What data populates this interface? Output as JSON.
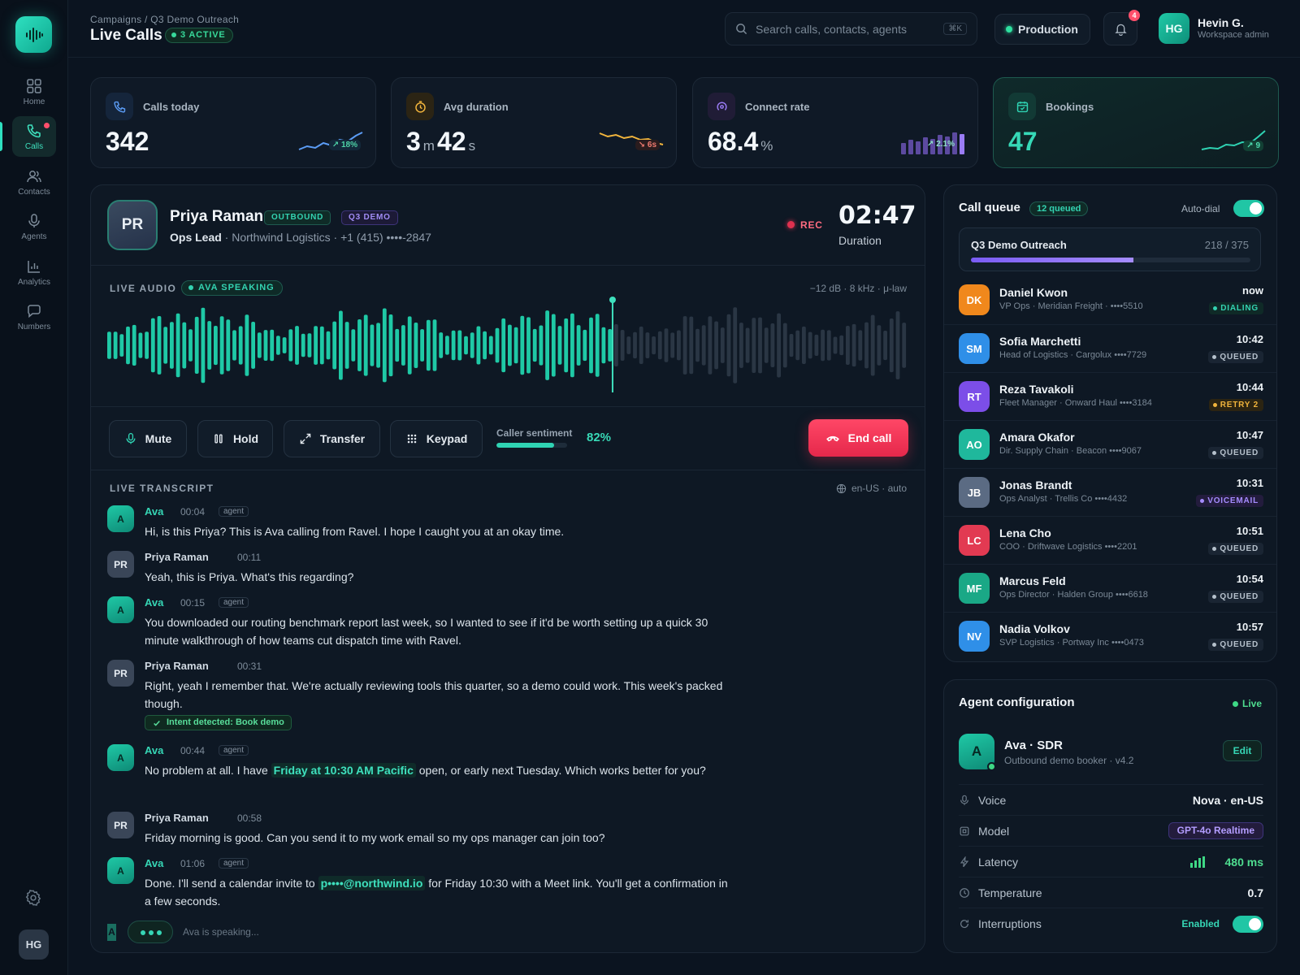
{
  "sidebar": {
    "items": [
      {
        "label": "Home"
      },
      {
        "label": "Calls"
      },
      {
        "label": "Contacts"
      },
      {
        "label": "Agents"
      },
      {
        "label": "Analytics"
      },
      {
        "label": "Numbers"
      }
    ],
    "avatar": "HG"
  },
  "header": {
    "breadcrumb": "Campaigns / Q3 Demo Outreach",
    "title": "Live Calls",
    "active_badge": "3 ACTIVE",
    "search_placeholder": "Search calls, contacts, agents",
    "search_shortcut": "⌘K",
    "environment": "Production",
    "notifications": "4",
    "user_initials": "HG",
    "user_name": "Hevin G.",
    "user_role": "Workspace admin"
  },
  "stats": [
    {
      "label": "Calls today",
      "value": "342",
      "delta": "↗ 18%",
      "icon": "phone-icon",
      "color": "#5b9cf5"
    },
    {
      "label": "Avg duration",
      "value_min": "3",
      "unit_min": "m",
      "value_sec": "42",
      "unit_sec": "s",
      "delta": "↘ 6s",
      "icon": "timer-icon",
      "color": "#f2b53c"
    },
    {
      "label": "Connect rate",
      "value": "68.4",
      "unit": "%",
      "delta": "↗ 2.1%",
      "icon": "connect-icon",
      "color": "#9a7cf5"
    },
    {
      "label": "Bookings",
      "value": "47",
      "delta": "↗ 9",
      "icon": "calendar-icon",
      "color": "#2fd3b3"
    }
  ],
  "call": {
    "initials": "PR",
    "name": "Priya Raman",
    "tag_direction": "OUTBOUND",
    "tag_campaign": "Q3 DEMO",
    "role": "Ops Lead",
    "company_phone": " · Northwind Logistics · +1 (415) ••••-2847",
    "rec": "REC",
    "timer": "02:47",
    "timer_label": "Duration",
    "audio_label": "LIVE AUDIO",
    "speaking_badge": "AVA SPEAKING",
    "audio_meta": "−12 dB · 8 kHz · μ-law",
    "controls": {
      "mute": "Mute",
      "hold": "Hold",
      "transfer": "Transfer",
      "keypad": "Keypad",
      "end": "End call"
    },
    "sentiment_label": "Caller sentiment",
    "sentiment_value": "82%",
    "sentiment_fraction": 0.82,
    "transcript_label": "LIVE TRANSCRIPT",
    "language": "en-US · auto",
    "transcript": [
      {
        "speaker": "Ava",
        "initials": "A",
        "time": "00:04",
        "tag": "agent",
        "text": "Hi, is this Priya? This is Ava calling from Ravel. I hope I caught you at an okay time."
      },
      {
        "speaker": "Priya Raman",
        "initials": "PR",
        "time": "00:11",
        "text": "Yeah, this is Priya. What's this regarding?"
      },
      {
        "speaker": "Ava",
        "initials": "A",
        "time": "00:15",
        "tag": "agent",
        "text": "You downloaded our routing benchmark report last week, so I wanted to see if it'd be worth setting up a quick 30 minute walkthrough of how teams cut dispatch time with Ravel."
      },
      {
        "speaker": "Priya Raman",
        "initials": "PR",
        "time": "00:31",
        "text": "Right, yeah I remember that. We're actually reviewing tools this quarter, so a demo could work. This week's packed though.",
        "intent": "Intent detected: Book demo"
      },
      {
        "speaker": "Ava",
        "initials": "A",
        "time": "00:44",
        "tag": "agent",
        "text_before": "No problem at all. I have ",
        "highlight": "Friday at 10:30 AM Pacific",
        "text_after": " open, or early next Tuesday. Which works better for you?"
      },
      {
        "speaker": "Priya Raman",
        "initials": "PR",
        "time": "00:58",
        "text": "Friday morning is good. Can you send it to my work email so my ops manager can join too?"
      },
      {
        "speaker": "Ava",
        "initials": "A",
        "time": "01:06",
        "tag": "agent",
        "text_before": "Done. I'll send a calendar invite to ",
        "highlight": "p••••@northwind.io",
        "text_after": " for Friday 10:30 with a Meet link. You'll get a confirmation in a few seconds."
      }
    ],
    "typing_initial": "A",
    "typing_text": "Ava is speaking..."
  },
  "queue": {
    "title": "Call queue",
    "count": "12 queued",
    "autodial_label": "Auto-dial",
    "campaign_name": "Q3 Demo Outreach",
    "campaign_progress": "218 / 375",
    "campaign_fraction": 0.581,
    "items": [
      {
        "initials": "DK",
        "name": "Daniel Kwon",
        "sub": "VP Ops · Meridian Freight · ••••5510",
        "time": "now",
        "status": "DIALING",
        "kind": "dialing",
        "color": "#f0881c"
      },
      {
        "initials": "SM",
        "name": "Sofia Marchetti",
        "sub": "Head of Logistics · Cargolux ••••7729",
        "time": "10:42",
        "status": "QUEUED",
        "kind": "queued",
        "color": "#2f8fe8"
      },
      {
        "initials": "RT",
        "name": "Reza Tavakoli",
        "sub": "Fleet Manager · Onward Haul ••••3184",
        "time": "10:44",
        "status": "RETRY 2",
        "kind": "retry",
        "color": "#7c4ee8"
      },
      {
        "initials": "AO",
        "name": "Amara Okafor",
        "sub": "Dir. Supply Chain · Beacon ••••9067",
        "time": "10:47",
        "status": "QUEUED",
        "kind": "queued",
        "color": "#1fb89c"
      },
      {
        "initials": "JB",
        "name": "Jonas Brandt",
        "sub": "Ops Analyst · Trellis Co ••••4432",
        "time": "10:31",
        "status": "VOICEMAIL",
        "kind": "voicemail",
        "color": "#5b6b83"
      },
      {
        "initials": "LC",
        "name": "Lena Cho",
        "sub": "COO · Driftwave Logistics ••••2201",
        "time": "10:51",
        "status": "QUEUED",
        "kind": "queued",
        "color": "#e23a52"
      },
      {
        "initials": "MF",
        "name": "Marcus Feld",
        "sub": "Ops Director · Halden Group ••••6618",
        "time": "10:54",
        "status": "QUEUED",
        "kind": "queued",
        "color": "#1aa886"
      },
      {
        "initials": "NV",
        "name": "Nadia Volkov",
        "sub": "SVP Logistics · Portway Inc ••••0473",
        "time": "10:57",
        "status": "QUEUED",
        "kind": "queued",
        "color": "#2f8fe8"
      }
    ]
  },
  "agent": {
    "title": "Agent configuration",
    "live": "Live",
    "initial": "A",
    "name": "Ava · SDR",
    "sub": "Outbound demo booker · v4.2",
    "edit": "Edit",
    "rows": {
      "voice_label": "Voice",
      "voice_value": "Nova · en-US",
      "model_label": "Model",
      "model_value": "GPT-4o Realtime",
      "latency_label": "Latency",
      "latency_value": "480 ms",
      "temperature_label": "Temperature",
      "temperature_value": "0.7",
      "interruptions_label": "Interruptions",
      "interruptions_value": "Enabled"
    }
  },
  "colors": {
    "accent": "#2fd3b3",
    "danger": "#e5284b",
    "purple": "#9a7cf5",
    "warning": "#f2b53c"
  }
}
